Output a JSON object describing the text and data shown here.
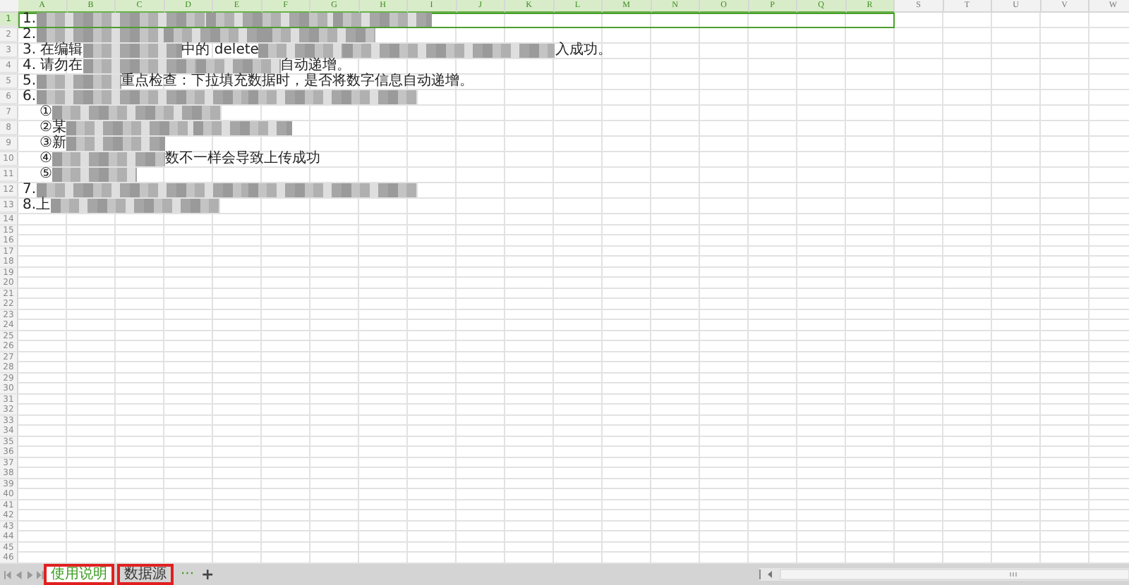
{
  "columns": [
    {
      "label": "A",
      "selected": true
    },
    {
      "label": "B",
      "selected": true
    },
    {
      "label": "C",
      "selected": true
    },
    {
      "label": "D",
      "selected": true
    },
    {
      "label": "E",
      "selected": true
    },
    {
      "label": "F",
      "selected": true
    },
    {
      "label": "G",
      "selected": true
    },
    {
      "label": "H",
      "selected": true
    },
    {
      "label": "I",
      "selected": true
    },
    {
      "label": "J",
      "selected": true
    },
    {
      "label": "K",
      "selected": true
    },
    {
      "label": "L",
      "selected": true
    },
    {
      "label": "M",
      "selected": true
    },
    {
      "label": "N",
      "selected": true
    },
    {
      "label": "O",
      "selected": true
    },
    {
      "label": "P",
      "selected": true
    },
    {
      "label": "Q",
      "selected": true
    },
    {
      "label": "R",
      "selected": true
    },
    {
      "label": "S",
      "selected": false
    },
    {
      "label": "T",
      "selected": false
    },
    {
      "label": "U",
      "selected": false
    },
    {
      "label": "V",
      "selected": false
    },
    {
      "label": "W",
      "selected": false
    }
  ],
  "rows": [
    {
      "number": "1",
      "selected": true,
      "kind": "item",
      "segments": [
        {
          "kind": "text",
          "text": "1."
        },
        {
          "kind": "blurred"
        },
        {
          "kind": "blurred"
        },
        {
          "kind": "blurred"
        }
      ]
    },
    {
      "number": "2",
      "selected": false,
      "kind": "item",
      "segments": [
        {
          "kind": "text",
          "text": "2."
        },
        {
          "kind": "blurred"
        },
        {
          "kind": "blurred"
        },
        {
          "kind": "blurred"
        }
      ]
    },
    {
      "number": "3",
      "selected": false,
      "kind": "item",
      "segments": [
        {
          "kind": "text",
          "text": "3. 在编辑"
        },
        {
          "kind": "blurred"
        },
        {
          "kind": "text",
          "text": "中的 delete"
        },
        {
          "kind": "blurred"
        },
        {
          "kind": "blurred"
        },
        {
          "kind": "text",
          "text": "入成功。"
        }
      ]
    },
    {
      "number": "4",
      "selected": false,
      "kind": "item",
      "segments": [
        {
          "kind": "text",
          "text": "4. 请勿在"
        },
        {
          "kind": "blurred"
        },
        {
          "kind": "blurred"
        },
        {
          "kind": "text",
          "text": "自动递增。"
        }
      ]
    },
    {
      "number": "5",
      "selected": false,
      "kind": "item",
      "segments": [
        {
          "kind": "text",
          "text": "5."
        },
        {
          "kind": "blurred"
        },
        {
          "kind": "text",
          "text": "重点检查：下拉填充数据时，是否将数字信息自动递增。"
        }
      ]
    },
    {
      "number": "6",
      "selected": false,
      "kind": "item",
      "segments": [
        {
          "kind": "text",
          "text": "6."
        },
        {
          "kind": "blurred"
        },
        {
          "kind": "blurred"
        }
      ]
    },
    {
      "number": "7",
      "selected": false,
      "kind": "sub",
      "segments": [
        {
          "kind": "text",
          "text": "①"
        },
        {
          "kind": "blurred"
        }
      ]
    },
    {
      "number": "8",
      "selected": false,
      "kind": "sub",
      "segments": [
        {
          "kind": "text",
          "text": "②某"
        },
        {
          "kind": "blurred"
        },
        {
          "kind": "blurred"
        }
      ]
    },
    {
      "number": "9",
      "selected": false,
      "kind": "sub",
      "segments": [
        {
          "kind": "text",
          "text": "③新"
        },
        {
          "kind": "blurred"
        }
      ]
    },
    {
      "number": "10",
      "selected": false,
      "kind": "sub",
      "segments": [
        {
          "kind": "text",
          "text": "④"
        },
        {
          "kind": "blurred"
        },
        {
          "kind": "text",
          "text": "数不一样会导致上传成功"
        }
      ]
    },
    {
      "number": "11",
      "selected": false,
      "kind": "sub",
      "segments": [
        {
          "kind": "text",
          "text": "⑤"
        },
        {
          "kind": "blurred"
        }
      ]
    },
    {
      "number": "12",
      "selected": false,
      "kind": "item",
      "segments": [
        {
          "kind": "text",
          "text": "7."
        },
        {
          "kind": "blurred"
        },
        {
          "kind": "blurred"
        }
      ]
    },
    {
      "number": "13",
      "selected": false,
      "kind": "item",
      "segments": [
        {
          "kind": "text",
          "text": "8.上"
        },
        {
          "kind": "blurred"
        }
      ]
    },
    {
      "number": "14",
      "selected": false
    },
    {
      "number": "15",
      "selected": false
    },
    {
      "number": "16",
      "selected": false
    },
    {
      "number": "17",
      "selected": false
    },
    {
      "number": "18",
      "selected": false
    },
    {
      "number": "19",
      "selected": false
    },
    {
      "number": "20",
      "selected": false
    },
    {
      "number": "21",
      "selected": false
    },
    {
      "number": "22",
      "selected": false
    },
    {
      "number": "23",
      "selected": false
    },
    {
      "number": "24",
      "selected": false
    },
    {
      "number": "25",
      "selected": false
    },
    {
      "number": "26",
      "selected": false
    },
    {
      "number": "27",
      "selected": false
    },
    {
      "number": "28",
      "selected": false
    },
    {
      "number": "29",
      "selected": false
    },
    {
      "number": "30",
      "selected": false
    },
    {
      "number": "31",
      "selected": false
    },
    {
      "number": "32",
      "selected": false
    },
    {
      "number": "33",
      "selected": false
    },
    {
      "number": "34",
      "selected": false
    },
    {
      "number": "35",
      "selected": false
    },
    {
      "number": "36",
      "selected": false
    },
    {
      "number": "37",
      "selected": false
    },
    {
      "number": "38",
      "selected": false
    },
    {
      "number": "39",
      "selected": false
    },
    {
      "number": "40",
      "selected": false
    },
    {
      "number": "41",
      "selected": false
    },
    {
      "number": "42",
      "selected": false
    },
    {
      "number": "43",
      "selected": false
    },
    {
      "number": "44",
      "selected": false
    },
    {
      "number": "45",
      "selected": false
    },
    {
      "number": "46",
      "selected": false
    }
  ],
  "sheet_tabs": [
    {
      "label": "使用说明",
      "selected": true,
      "highlighted": true
    },
    {
      "label": "数据源",
      "selected": false,
      "highlighted": true
    }
  ],
  "tab_more": "···",
  "tab_add": "+"
}
